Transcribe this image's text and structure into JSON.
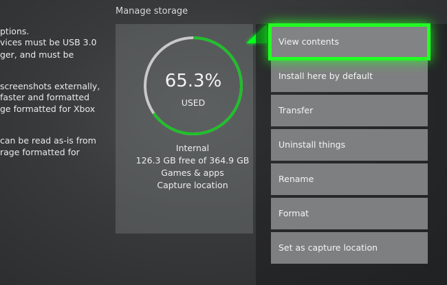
{
  "background_text": [
    "ptions.",
    "vices must be USB 3.0",
    "ger, and must be",
    "screenshots externally,",
    "faster and formatted",
    "ge formatted for Xbox",
    "can be read as-is from",
    "rage formatted for"
  ],
  "page_title": "Manage storage",
  "storage": {
    "percent_label": "65.3%",
    "used_fraction": 0.653,
    "used_label": "USED",
    "drive_name": "Internal",
    "free_text": "126.3 GB free of 364.9 GB",
    "content_type": "Games & apps",
    "capture_location": "Capture location"
  },
  "menu": {
    "items": [
      {
        "label": "View contents",
        "selected": true
      },
      {
        "label": "Install here by default",
        "selected": false
      },
      {
        "label": "Transfer",
        "selected": false
      },
      {
        "label": "Uninstall things",
        "selected": false
      },
      {
        "label": "Rename",
        "selected": false
      },
      {
        "label": "Format",
        "selected": false
      },
      {
        "label": "Set as capture location",
        "selected": false
      }
    ]
  },
  "colors": {
    "accent_green": "#22ff22",
    "gauge_used": "#1fbf2a",
    "gauge_free": "#c9c9c9",
    "menu_bg": "#7d7f80"
  }
}
